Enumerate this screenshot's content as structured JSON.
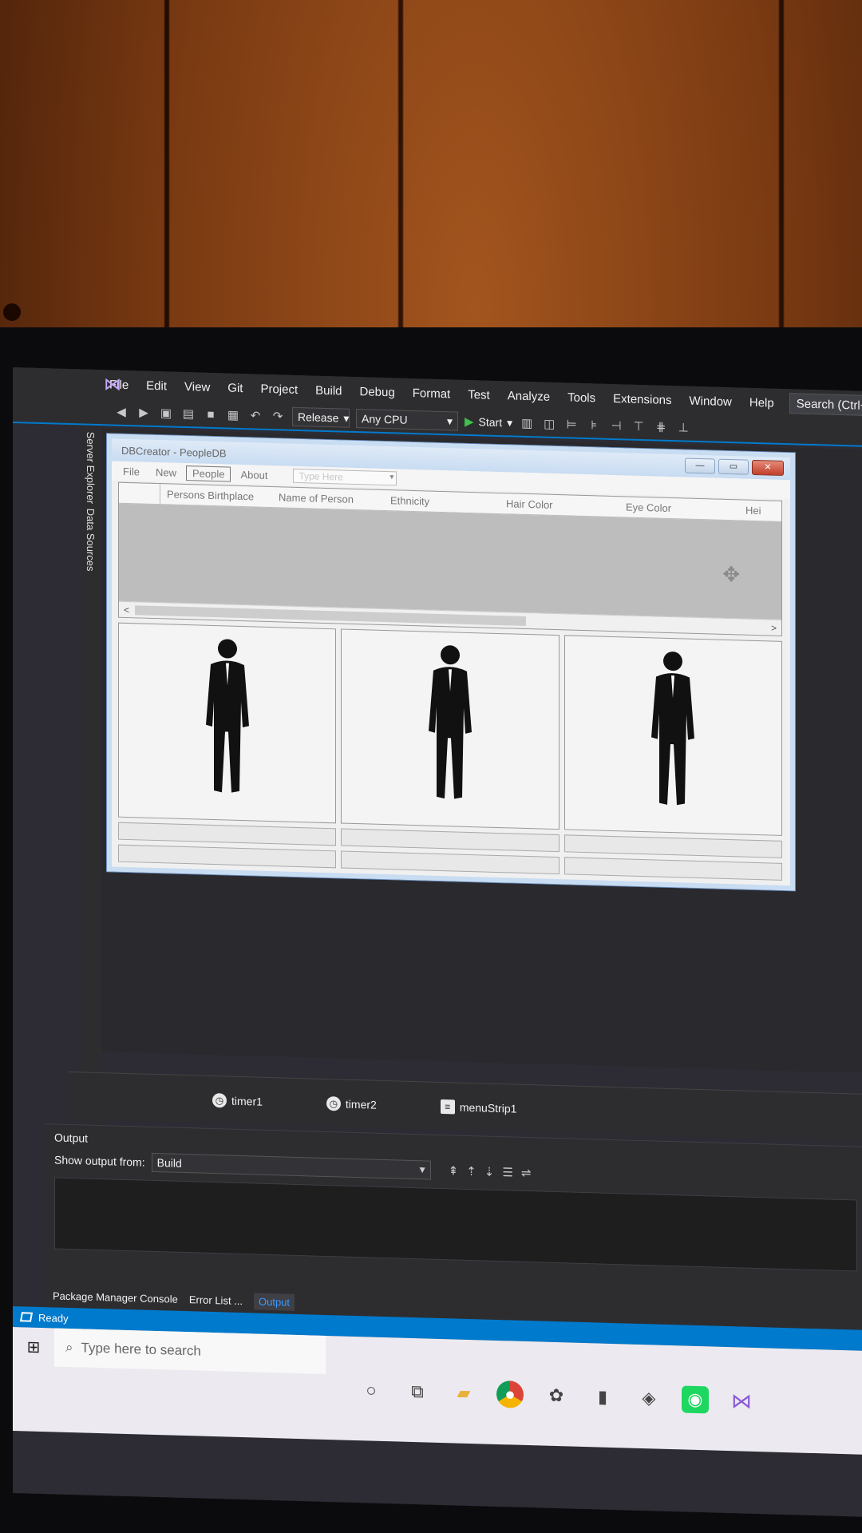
{
  "ide": {
    "menu": [
      "File",
      "Edit",
      "View",
      "Git",
      "Project",
      "Build",
      "Debug",
      "Format",
      "Test",
      "Analyze",
      "Tools",
      "Extensions",
      "Window",
      "Help"
    ],
    "search_label": "Search (Ctrl+",
    "toolbar": {
      "configuration": "Release",
      "platform": "Any CPU",
      "start_label": "Start"
    },
    "left_rail": [
      "Server Explorer",
      "Data Sources"
    ]
  },
  "form": {
    "title": "DBCreator - PeopleDB",
    "menu": [
      "File",
      "New",
      "People",
      "About"
    ],
    "active_menu": "People",
    "type_here_placeholder": "Type Here",
    "grid_columns": [
      "Persons Birthplace",
      "Name of Person",
      "Ethnicity",
      "Hair Color",
      "Eye Color",
      "Hei"
    ],
    "scroll_left": "<",
    "scroll_right": ">"
  },
  "tray": [
    "timer1",
    "timer2",
    "menuStrip1"
  ],
  "output": {
    "title": "Output",
    "show_from_label": "Show output from:",
    "show_from_value": "Build"
  },
  "bottom_tabs": [
    "Package Manager Console",
    "Error List ...",
    "Output"
  ],
  "status": {
    "text": "Ready"
  },
  "taskbar": {
    "search_placeholder": "Type here to search"
  }
}
